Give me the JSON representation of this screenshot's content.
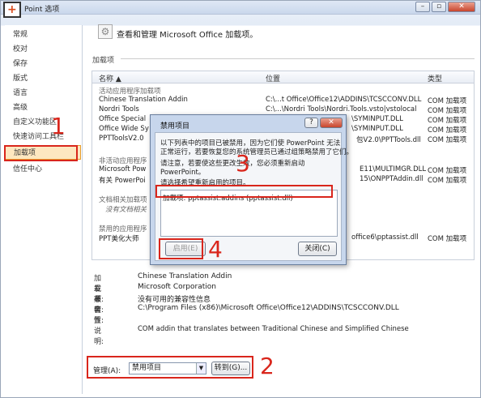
{
  "window": {
    "title": "Point 选项",
    "controls": [
      "–",
      "▫",
      "✕"
    ]
  },
  "sidebar": {
    "items": [
      {
        "label": "常规"
      },
      {
        "label": "校对"
      },
      {
        "label": "保存"
      },
      {
        "label": "版式"
      },
      {
        "label": "语言"
      },
      {
        "label": "高级"
      },
      {
        "label": "自定义功能区"
      },
      {
        "label": "快速访问工具栏"
      },
      {
        "label": "加载项"
      },
      {
        "label": "信任中心"
      }
    ]
  },
  "annotations": {
    "n1": "1",
    "n2": "2",
    "n3": "3",
    "n4": "4"
  },
  "main": {
    "heading": "查看和管理 Microsoft Office 加载项。",
    "section_label": "加载项",
    "table": {
      "headers": {
        "name": "名称 ▲",
        "location": "位置",
        "type": "类型"
      },
      "group_active": "活动应用程序加载项",
      "rows_active": [
        {
          "name": "Chinese Translation Addin",
          "location": "C:\\...t Office\\Office12\\ADDINS\\TCSCCONV.DLL",
          "type": "COM 加载项"
        },
        {
          "name": "Nordri Tools",
          "location": "C:\\...\\Nordri Tools\\Nordri.Tools.vsto|vstolocal",
          "type": "COM 加载项"
        },
        {
          "name": "Office Special",
          "location": "\\SYMINPUT.DLL",
          "type": "COM 加载项"
        },
        {
          "name": "Office Wide Sy",
          "location": "\\SYMINPUT.DLL",
          "type": "COM 加载项"
        },
        {
          "name": "PPTToolsV2.0",
          "location": "包V2.0\\PPTTools.dll",
          "type": "COM 加载项"
        }
      ],
      "group_inactive": "非活动应用程序",
      "rows_inactive": [
        {
          "name": "Microsoft Pow",
          "location": "E11\\MULTIMGR.DLL",
          "type": "COM 加载项"
        },
        {
          "name": "有关 PowerPoi",
          "location": "15\\ONPPTAddin.dll",
          "type": "COM 加载项"
        }
      ],
      "group_doc": "文档相关加载项",
      "doc_empty": "没有文档相关",
      "group_disabled": "禁用的应用程序",
      "rows_disabled": [
        {
          "name": "PPT美化大师",
          "location": "office6\\pptassist.dll",
          "type": "COM 加载项"
        }
      ]
    },
    "details": {
      "addin_k": "加载项:",
      "addin_v": "Chinese Translation Addin",
      "publisher_k": "发布者:",
      "publisher_v": "Microsoft Corporation",
      "compat_k": "兼容性:",
      "compat_v": "没有可用的兼容性信息",
      "location_k": "位置:",
      "location_v": "C:\\Program Files (x86)\\Microsoft Office\\Office12\\ADDINS\\TCSCCONV.DLL",
      "desc_k": "说明:",
      "desc_v": "COM addin that translates between Traditional Chinese and Simplified Chinese"
    },
    "manage": {
      "label": "管理(A):",
      "selected": "禁用项目",
      "go_label": "转到(G)..."
    }
  },
  "dialog": {
    "title": "禁用项目",
    "help": "?",
    "close": "✕",
    "msg1": "以下列表中的项目已被禁用，因为它们使 PowerPoint 无法",
    "msg2": "正常运行，若要恢复您的系统管理员已通过组策略禁用了它们。",
    "msg3": "请注意，若要使这些更改生效，您必须重新启动",
    "msg4": "PowerPoint。",
    "msg5": "请选择希望重新启用的项目。",
    "item": "加载项: pptassist.addins (pptassist.dll)",
    "enable_label": "启用(E)",
    "close_label": "关闭(C)"
  }
}
